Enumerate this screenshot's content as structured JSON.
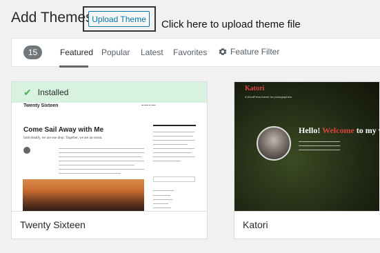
{
  "header": {
    "title": "Add Themes",
    "upload_label": "Upload Theme",
    "annotation": "Click here to upload theme file"
  },
  "filter": {
    "count": "15",
    "tabs": [
      "Featured",
      "Popular",
      "Latest",
      "Favorites"
    ],
    "current_tab": "Featured",
    "feature_filter_label": "Feature Filter"
  },
  "themes": [
    {
      "name": "Twenty Sixteen",
      "installed_label": "Installed",
      "preview": {
        "site_title": "Twenty Sixteen",
        "hero": "Come Sail Away with Me",
        "subtitle": "Individually, we are one drop. Together, we are an ocean."
      }
    },
    {
      "name": "Katori",
      "preview": {
        "site_title": "Katori",
        "tagline": "A WordPress theme for photographers",
        "hello": "Hello!",
        "welcome": "Welcome",
        "rest": "to my w"
      }
    }
  ],
  "colors": {
    "accent": "#0073aa",
    "installed_bg": "#d7f2de",
    "check": "#46b450",
    "count_badge": "#72777c"
  }
}
